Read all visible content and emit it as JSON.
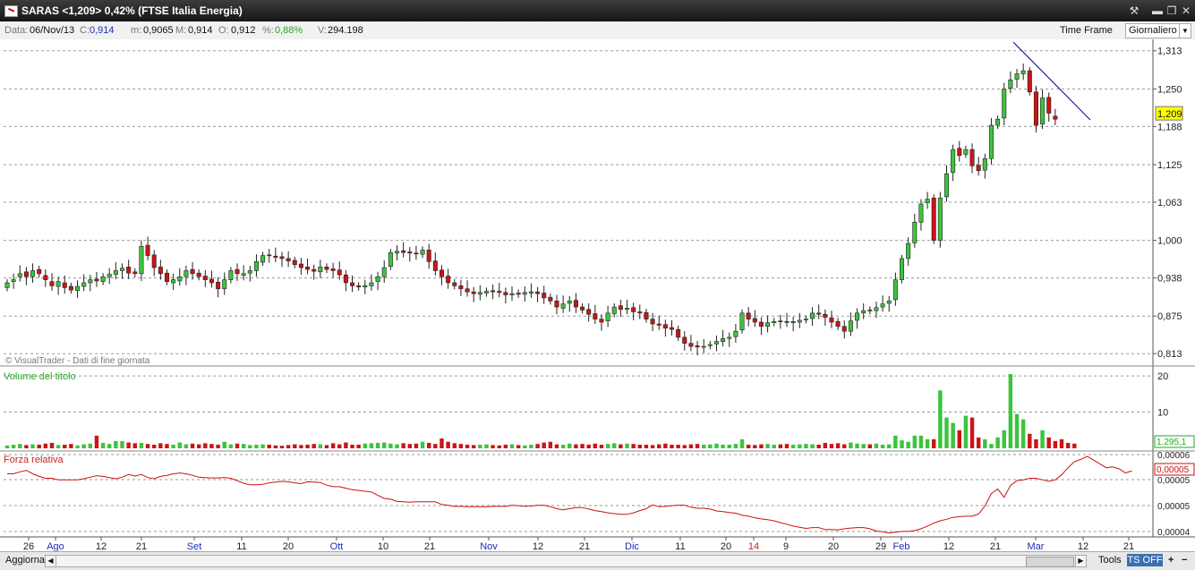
{
  "window": {
    "title": "SARAS <1,209> 0,42%  (FTSE Italia Energia)",
    "controls": {
      "tool": "⚒",
      "minimize": "▬",
      "maximize": "❐",
      "close": "✕"
    }
  },
  "infobar": {
    "data_label": "Data:",
    "data_value": "06/Nov/13",
    "c_label": "C:",
    "c_value": "0,914",
    "m_label": "m:",
    "m_value": "0,9065",
    "M_label": "M:",
    "M_value": "0,914",
    "o_label": "O:",
    "o_value": "0,912",
    "pct_label": "%:",
    "pct_value": "0,88%",
    "v_label": "V:",
    "v_value": "294.198",
    "time_frame_label": "Time Frame",
    "time_frame_value": "Giornaliero"
  },
  "colors": {
    "up": "#3cc43c",
    "down": "#cc1414",
    "trendline": "#0000aa",
    "volume_label": "#22aa22",
    "rs_label": "#cc2222",
    "axis_blue": "#1b2fb5",
    "axis_red": "#d02020"
  },
  "chart_data": [
    {
      "type": "candlestick",
      "title": "SARAS <1,209> 0,42%  (FTSE Italia Energia)",
      "watermark": "© VisualTrader - Dati di fine giornata",
      "y_ticks": [
        "1,313",
        "1,250",
        "1,188",
        "1,125",
        "1,063",
        "1,000",
        "0,938",
        "0,875",
        "0,813"
      ],
      "y_range": [
        0.8,
        1.32
      ],
      "last_price_label": "1,209",
      "x_ticks": [
        {
          "label": "26",
          "style": "normal"
        },
        {
          "label": "Ago",
          "style": "month"
        },
        {
          "label": "12",
          "style": "normal"
        },
        {
          "label": "21",
          "style": "normal"
        },
        {
          "label": "Set",
          "style": "month"
        },
        {
          "label": "11",
          "style": "normal"
        },
        {
          "label": "20",
          "style": "normal"
        },
        {
          "label": "Ott",
          "style": "month"
        },
        {
          "label": "10",
          "style": "normal"
        },
        {
          "label": "21",
          "style": "normal"
        },
        {
          "label": "Nov",
          "style": "month"
        },
        {
          "label": "12",
          "style": "normal"
        },
        {
          "label": "21",
          "style": "normal"
        },
        {
          "label": "Dic",
          "style": "month"
        },
        {
          "label": "11",
          "style": "normal"
        },
        {
          "label": "20",
          "style": "normal"
        },
        {
          "label": "14",
          "style": "year"
        },
        {
          "label": "9",
          "style": "normal"
        },
        {
          "label": "20",
          "style": "normal"
        },
        {
          "label": "29",
          "style": "normal"
        },
        {
          "label": "Feb",
          "style": "month"
        },
        {
          "label": "12",
          "style": "normal"
        },
        {
          "label": "21",
          "style": "normal"
        },
        {
          "label": "Mar",
          "style": "month"
        },
        {
          "label": "12",
          "style": "normal"
        },
        {
          "label": "21",
          "style": "normal"
        }
      ],
      "close": [
        0.93,
        0.935,
        0.945,
        0.94,
        0.95,
        0.945,
        0.935,
        0.925,
        0.932,
        0.922,
        0.918,
        0.924,
        0.93,
        0.935,
        0.933,
        0.94,
        0.944,
        0.95,
        0.954,
        0.946,
        0.945,
        0.99,
        0.975,
        0.955,
        0.945,
        0.932,
        0.935,
        0.94,
        0.95,
        0.945,
        0.94,
        0.935,
        0.93,
        0.92,
        0.935,
        0.95,
        0.945,
        0.945,
        0.95,
        0.965,
        0.975,
        0.975,
        0.972,
        0.97,
        0.966,
        0.96,
        0.955,
        0.952,
        0.949,
        0.956,
        0.952,
        0.95,
        0.943,
        0.93,
        0.925,
        0.923,
        0.925,
        0.93,
        0.94,
        0.955,
        0.98,
        0.982,
        0.98,
        0.979,
        0.978,
        0.984,
        0.965,
        0.95,
        0.94,
        0.93,
        0.925,
        0.92,
        0.915,
        0.912,
        0.914,
        0.916,
        0.915,
        0.914,
        0.91,
        0.912,
        0.911,
        0.914,
        0.915,
        0.912,
        0.905,
        0.9,
        0.89,
        0.895,
        0.9,
        0.89,
        0.885,
        0.878,
        0.87,
        0.865,
        0.88,
        0.89,
        0.886,
        0.888,
        0.882,
        0.88,
        0.87,
        0.862,
        0.86,
        0.855,
        0.853,
        0.84,
        0.83,
        0.825,
        0.824,
        0.825,
        0.828,
        0.833,
        0.838,
        0.84,
        0.85,
        0.88,
        0.87,
        0.865,
        0.858,
        0.864,
        0.866,
        0.866,
        0.865,
        0.866,
        0.868,
        0.87,
        0.88,
        0.878,
        0.873,
        0.865,
        0.858,
        0.85,
        0.867,
        0.88,
        0.884,
        0.884,
        0.889,
        0.895,
        0.9,
        0.935,
        0.97,
        0.995,
        1.03,
        1.06,
        1.068,
        1.0,
        1.07,
        1.11,
        1.15,
        1.14,
        1.15,
        1.123,
        1.115,
        1.135,
        1.19,
        1.2,
        1.25,
        1.265,
        1.275,
        1.28,
        1.245,
        1.19,
        1.235,
        1.21,
        1.2,
        1.209
      ],
      "open": [
        0.922,
        0.932,
        0.94,
        0.948,
        0.94,
        0.952,
        0.942,
        0.932,
        0.924,
        0.93,
        0.924,
        0.917,
        0.924,
        0.93,
        0.936,
        0.932,
        0.94,
        0.944,
        0.95,
        0.956,
        0.948,
        0.945,
        0.992,
        0.976,
        0.956,
        0.946,
        0.93,
        0.933,
        0.94,
        0.952,
        0.946,
        0.941,
        0.936,
        0.931,
        0.92,
        0.935,
        0.952,
        0.942,
        0.946,
        0.95,
        0.964,
        0.976,
        0.974,
        0.973,
        0.97,
        0.967,
        0.961,
        0.956,
        0.952,
        0.948,
        0.956,
        0.953,
        0.951,
        0.943,
        0.93,
        0.925,
        0.923,
        0.925,
        0.932,
        0.94,
        0.957,
        0.979,
        0.983,
        0.981,
        0.979,
        0.977,
        0.984,
        0.966,
        0.951,
        0.941,
        0.93,
        0.925,
        0.92,
        0.915,
        0.911,
        0.913,
        0.917,
        0.916,
        0.914,
        0.91,
        0.913,
        0.911,
        0.913,
        0.915,
        0.913,
        0.906,
        0.9,
        0.888,
        0.896,
        0.901,
        0.89,
        0.886,
        0.879,
        0.87,
        0.867,
        0.879,
        0.892,
        0.886,
        0.889,
        0.882,
        0.881,
        0.87,
        0.862,
        0.861,
        0.856,
        0.853,
        0.84,
        0.83,
        0.826,
        0.824,
        0.826,
        0.829,
        0.833,
        0.838,
        0.841,
        0.852,
        0.88,
        0.871,
        0.865,
        0.858,
        0.864,
        0.867,
        0.866,
        0.864,
        0.865,
        0.869,
        0.871,
        0.88,
        0.878,
        0.872,
        0.866,
        0.858,
        0.85,
        0.868,
        0.88,
        0.885,
        0.884,
        0.89,
        0.896,
        0.902,
        0.935,
        0.97,
        0.996,
        1.03,
        1.062,
        1.07,
        1.0,
        1.072,
        1.112,
        1.152,
        1.142,
        1.15,
        1.124,
        1.116,
        1.135,
        1.19,
        1.202,
        1.251,
        1.266,
        1.275,
        1.28,
        1.245,
        1.192,
        1.236,
        1.205
      ],
      "volume_panel": {
        "label": "Volume del titolo",
        "y_ticks": [
          "20",
          "10"
        ],
        "y_range": [
          0,
          22
        ],
        "last_value_label": "1.295,1",
        "values": [
          0.8,
          1.0,
          1.2,
          0.9,
          1.1,
          1.0,
          1.3,
          1.5,
          0.9,
          1.0,
          1.2,
          0.8,
          1.1,
          1.3,
          3.5,
          1.5,
          1.2,
          2.0,
          2.0,
          1.6,
          1.4,
          1.5,
          1.2,
          1.0,
          1.4,
          1.2,
          1.0,
          1.6,
          1.1,
          1.3,
          1.1,
          1.4,
          1.2,
          1.0,
          1.8,
          1.1,
          1.3,
          1.2,
          0.9,
          1.0,
          1.1,
          1.0,
          0.8,
          0.7,
          0.9,
          1.1,
          0.9,
          1.0,
          1.2,
          1.1,
          0.9,
          1.4,
          1.1,
          1.6,
          1.0,
          1.0,
          1.3,
          1.4,
          1.5,
          1.6,
          1.3,
          1.1,
          1.4,
          1.2,
          1.3,
          1.8,
          1.5,
          1.2,
          2.7,
          1.8,
          1.4,
          1.2,
          1.0,
          0.9,
          1.0,
          1.1,
          0.9,
          0.8,
          1.0,
          1.1,
          0.9,
          0.8,
          1.0,
          1.2,
          1.6,
          1.8,
          1.1,
          1.0,
          1.3,
          1.1,
          1.2,
          1.0,
          1.3,
          1.0,
          1.2,
          1.4,
          1.1,
          1.3,
          1.2,
          1.0,
          1.0,
          0.9,
          1.1,
          1.3,
          1.0,
          1.0,
          0.9,
          1.1,
          1.2,
          1.0,
          1.1,
          1.3,
          1.0,
          1.0,
          1.2,
          2.5,
          1.0,
          0.9,
          1.1,
          1.2,
          1.0,
          1.1,
          1.2,
          1.0,
          1.1,
          1.2,
          1.1,
          1.0,
          1.5,
          1.2,
          1.4,
          1.1,
          1.6,
          1.3,
          1.2,
          1.1,
          1.3,
          1.0,
          1.1,
          3.5,
          2.2,
          1.8,
          3.5,
          3.5,
          2.5,
          2.5,
          16.0,
          8.5,
          7.0,
          5.0,
          9.0,
          8.5,
          3.0,
          2.5,
          1.2,
          3.0,
          5.0,
          20.5,
          9.5,
          8.0,
          4.0,
          2.5,
          5.0,
          3.0,
          2.0,
          2.5,
          1.5,
          1.3
        ]
      },
      "rs_panel": {
        "label": "Forza relativa",
        "y_ticks": [
          "0,00006",
          "0,00005",
          "0,00005",
          "0,00004"
        ],
        "y_range": [
          3.95e-05,
          6.05e-05
        ],
        "last_value_label": "0,00005",
        "values": [
          5.52e-05,
          5.52e-05,
          5.57e-05,
          5.61e-05,
          5.52e-05,
          5.45e-05,
          5.4e-05,
          5.4e-05,
          5.36e-05,
          5.36e-05,
          5.36e-05,
          5.36e-05,
          5.39e-05,
          5.43e-05,
          5.47e-05,
          5.45e-05,
          5.42e-05,
          5.39e-05,
          5.43e-05,
          5.5e-05,
          5.46e-05,
          5.5e-05,
          5.42e-05,
          5.39e-05,
          5.45e-05,
          5.48e-05,
          5.52e-05,
          5.54e-05,
          5.52e-05,
          5.48e-05,
          5.43e-05,
          5.42e-05,
          5.41e-05,
          5.41e-05,
          5.42e-05,
          5.4e-05,
          5.34e-05,
          5.27e-05,
          5.23e-05,
          5.23e-05,
          5.24e-05,
          5.28e-05,
          5.3e-05,
          5.32e-05,
          5.31e-05,
          5.28e-05,
          5.26e-05,
          5.31e-05,
          5.3e-05,
          5.29e-05,
          5.22e-05,
          5.18e-05,
          5.18e-05,
          5.14e-05,
          5.1e-05,
          5.08e-05,
          5.06e-05,
          5.04e-05,
          4.95e-05,
          4.87e-05,
          4.85e-05,
          4.79e-05,
          4.78e-05,
          4.77e-05,
          4.78e-05,
          4.78e-05,
          4.78e-05,
          4.78e-05,
          4.71e-05,
          4.69e-05,
          4.66e-05,
          4.66e-05,
          4.65e-05,
          4.65e-05,
          4.65e-05,
          4.65e-05,
          4.66e-05,
          4.66e-05,
          4.66e-05,
          4.69e-05,
          4.68e-05,
          4.66e-05,
          4.67e-05,
          4.69e-05,
          4.69e-05,
          4.65e-05,
          4.6e-05,
          4.57e-05,
          4.6e-05,
          4.63e-05,
          4.63e-05,
          4.59e-05,
          4.55e-05,
          4.52e-05,
          4.49e-05,
          4.47e-05,
          4.45e-05,
          4.45e-05,
          4.49e-05,
          4.55e-05,
          4.6e-05,
          4.7e-05,
          4.65e-05,
          4.66e-05,
          4.68e-05,
          4.69e-05,
          4.69e-05,
          4.64e-05,
          4.61e-05,
          4.61e-05,
          4.59e-05,
          4.54e-05,
          4.52e-05,
          4.5e-05,
          4.48e-05,
          4.43e-05,
          4.4e-05,
          4.36e-05,
          4.33e-05,
          4.31e-05,
          4.28e-05,
          4.23e-05,
          4.19e-05,
          4.14e-05,
          4.11e-05,
          4.08e-05,
          4.1e-05,
          4.1e-05,
          4.05e-05,
          4.05e-05,
          4.04e-05,
          4.07e-05,
          4.09e-05,
          4.1e-05,
          4.1e-05,
          4.07e-05,
          4.01e-05,
          3.99e-05,
          3.96e-05,
          3.98e-05,
          4e-05,
          4e-05,
          4.02e-05,
          4.07e-05,
          4.14e-05,
          4.22e-05,
          4.28e-05,
          4.32e-05,
          4.37e-05,
          4.39e-05,
          4.4e-05,
          4.4e-05,
          4.46e-05,
          4.67e-05,
          5e-05,
          5.12e-05,
          4.9e-05,
          5.21e-05,
          5.34e-05,
          5.36e-05,
          5.4e-05,
          5.4e-05,
          5.36e-05,
          5.32e-05,
          5.36e-05,
          5.49e-05,
          5.68e-05,
          5.84e-05,
          5.9e-05,
          5.98e-05,
          5.88e-05,
          5.78e-05,
          5.68e-05,
          5.7e-05,
          5.65e-05,
          5.54e-05,
          5.6e-05
        ]
      }
    }
  ],
  "footer": {
    "aggiorna_label": "Aggiorna",
    "tools_label": "Tools",
    "ts_off_label": "TS OFF",
    "plus_label": "+",
    "minus_label": "−"
  }
}
